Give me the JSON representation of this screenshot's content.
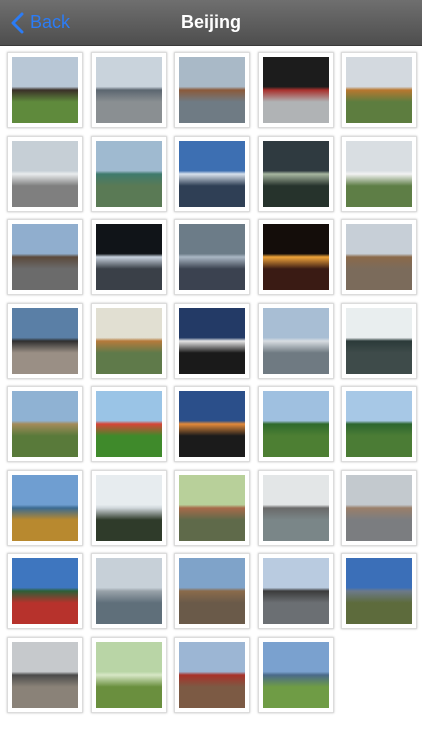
{
  "navbar": {
    "back_label": "Back",
    "title": "Beijing",
    "accent": "#2b7cf6"
  },
  "thumbnails": [
    {
      "name": "statue-on-plinth",
      "sky": "#b8c7d6",
      "ground": "#5f8a3c",
      "accent": "#3a3028"
    },
    {
      "name": "city-skyline-construction",
      "sky": "#c9d3dc",
      "ground": "#8a8f92",
      "accent": "#5b6670"
    },
    {
      "name": "palace-by-lake",
      "sky": "#a9b9c7",
      "ground": "#6f7b84",
      "accent": "#8b5a3a"
    },
    {
      "name": "forbidden-city-gate",
      "sky": "#1c1c1c",
      "ground": "#b0b3b5",
      "accent": "#a8302c"
    },
    {
      "name": "summer-palace-hill",
      "sky": "#d3d9df",
      "ground": "#5d7d3f",
      "accent": "#b8772f"
    },
    {
      "name": "high-speed-train",
      "sky": "#c6cfd6",
      "ground": "#7f7f7f",
      "accent": "#e9ecee"
    },
    {
      "name": "green-towers-aerial",
      "sky": "#9fbad0",
      "ground": "#5a7a55",
      "accent": "#3f7a6d"
    },
    {
      "name": "glass-office-tower",
      "sky": "#3d6fb2",
      "ground": "#2f3f55",
      "accent": "#d7e1ec"
    },
    {
      "name": "night-canal",
      "sky": "#2f3a40",
      "ground": "#26332c",
      "accent": "#a7b6a0"
    },
    {
      "name": "parked-white-car",
      "sky": "#d9dee2",
      "ground": "#5e7e46",
      "accent": "#f2f2f2"
    },
    {
      "name": "arrow-tower-gate",
      "sky": "#90aece",
      "ground": "#6b6b6b",
      "accent": "#5b4a3c"
    },
    {
      "name": "lit-skyscraper-night",
      "sky": "#101418",
      "ground": "#3a4048",
      "accent": "#c8d2de"
    },
    {
      "name": "cctv-like-tower",
      "sky": "#6c7c88",
      "ground": "#3b4250",
      "accent": "#aab7c4"
    },
    {
      "name": "flame-sculpture-night",
      "sky": "#140d0a",
      "ground": "#3a1b14",
      "accent": "#f0a43a"
    },
    {
      "name": "pagoda-dusk",
      "sky": "#c7cfd7",
      "ground": "#7b6b5b",
      "accent": "#8b6a4a"
    },
    {
      "name": "modern-building-front",
      "sky": "#5a7fa6",
      "ground": "#9a8f85",
      "accent": "#2f2f2f"
    },
    {
      "name": "temple-by-water",
      "sky": "#e1dfd2",
      "ground": "#5f7a4a",
      "accent": "#b67a3b"
    },
    {
      "name": "tree-sculpture",
      "sky": "#233a66",
      "ground": "#1a1a1a",
      "accent": "#e6e6e6"
    },
    {
      "name": "palace-by-lake-blue",
      "sky": "#a8bed4",
      "ground": "#6f7a82",
      "accent": "#d8dde2"
    },
    {
      "name": "bronze-head-sculpture",
      "sky": "#e9eeef",
      "ground": "#3e4b4a",
      "accent": "#2b3a39"
    },
    {
      "name": "pavilion-on-hill",
      "sky": "#8fb2d3",
      "ground": "#597a3a",
      "accent": "#a48b5a"
    },
    {
      "name": "flower-ribbon-garden",
      "sky": "#9ac4e6",
      "ground": "#3f8a2b",
      "accent": "#d64537"
    },
    {
      "name": "sunset-tree-silhouette",
      "sky": "#2b4f8a",
      "ground": "#1b1b1b",
      "accent": "#e28a3a"
    },
    {
      "name": "wetland-pond-1",
      "sky": "#9fc0e0",
      "ground": "#4d7f33",
      "accent": "#2f6a2c"
    },
    {
      "name": "wetland-pond-2",
      "sky": "#a7c8e6",
      "ground": "#4b7c35",
      "accent": "#2d662f"
    },
    {
      "name": "autumn-lakeside",
      "sky": "#6f9ed1",
      "ground": "#b8892f",
      "accent": "#3c6b91"
    },
    {
      "name": "stone-arch-bridge",
      "sky": "#e7ecef",
      "ground": "#2f3b2a",
      "accent": "#cfd6da"
    },
    {
      "name": "canal-boats",
      "sky": "#b8d09a",
      "ground": "#5f6a4a",
      "accent": "#a76a4a"
    },
    {
      "name": "office-building-river",
      "sky": "#e3e6e7",
      "ground": "#7a8688",
      "accent": "#6a6a6a"
    },
    {
      "name": "apartment-towers-street",
      "sky": "#c3c9ce",
      "ground": "#7b7d80",
      "accent": "#9a7f6a"
    },
    {
      "name": "red-temple-eaves",
      "sky": "#3e76bf",
      "ground": "#b7322c",
      "accent": "#2c5f38"
    },
    {
      "name": "river-skyline",
      "sky": "#c7d0d8",
      "ground": "#5f6f7a",
      "accent": "#9aa3aa"
    },
    {
      "name": "drum-tower",
      "sky": "#7fa3c9",
      "ground": "#6a5a49",
      "accent": "#8a6b4b"
    },
    {
      "name": "bronze-cauldron-street",
      "sky": "#b9cbe0",
      "ground": "#6b6f73",
      "accent": "#3b3b3b"
    },
    {
      "name": "mountain-landscape",
      "sky": "#3b6fb8",
      "ground": "#5d6b3c",
      "accent": "#6c7a8a"
    },
    {
      "name": "gate-tower-mist",
      "sky": "#c6c9cc",
      "ground": "#8a8278",
      "accent": "#4a4a4a"
    },
    {
      "name": "willow-pond",
      "sky": "#b9d5a6",
      "ground": "#6a8f3e",
      "accent": "#d7e7c6"
    },
    {
      "name": "painted-gateway",
      "sky": "#9cb6d4",
      "ground": "#7c5a44",
      "accent": "#a8322a"
    },
    {
      "name": "glass-highrise-lawn",
      "sky": "#7aa1cf",
      "ground": "#6f9c45",
      "accent": "#4a6a8a"
    }
  ]
}
